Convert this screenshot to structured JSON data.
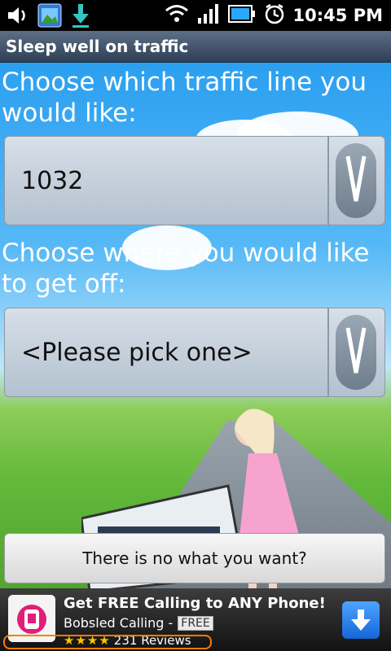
{
  "status_bar": {
    "time": "10:45 PM",
    "icons": [
      "volume-icon",
      "gallery-icon",
      "download-icon",
      "wifi-icon",
      "signal-icon",
      "battery-icon",
      "alarm-icon"
    ]
  },
  "app": {
    "title": "Sleep well on traffic"
  },
  "main": {
    "line_label": "Choose which traffic line you would like:",
    "line_value": "1032",
    "stop_label": "Choose where you would like to get off:",
    "stop_value": "<Please pick one>",
    "help_button": "There is no what you want?"
  },
  "ad": {
    "headline": "Get FREE Calling to ANY Phone!",
    "app_name": "Bobsled Calling -",
    "badge": "FREE",
    "stars": "★★★★",
    "reviews": "231 Reviews"
  },
  "colors": {
    "title_bar": "#3d4f66",
    "ad_accent": "#1565d8",
    "highlight": "#ff7a00"
  }
}
